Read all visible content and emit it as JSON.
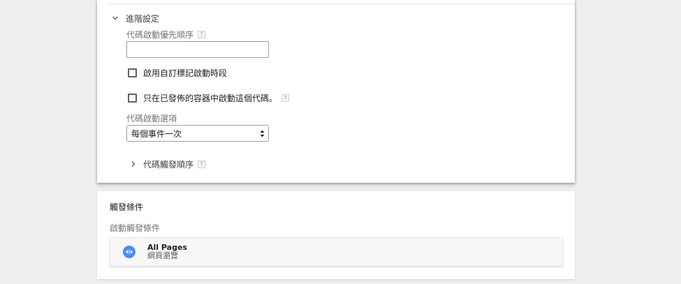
{
  "advanced": {
    "header": "進階設定",
    "priority_label": "代碼啟動優先順序",
    "priority_value": "",
    "custom_schedule_label": "啟用自訂標記啟動時段",
    "custom_schedule_checked": false,
    "published_only_label": "只在已發佈的容器中啟動這個代碼。",
    "published_only_checked": false,
    "firing_options_label": "代碼啟動選項",
    "firing_options_value": "每個事件一次",
    "sequencing_label": "代碼觸發順序",
    "help_glyph": "?"
  },
  "triggering": {
    "title": "觸發條件",
    "subtitle": "啟動觸發條件",
    "trigger": {
      "name": "All Pages",
      "type": "網頁瀏覽",
      "icon": "eye-icon",
      "icon_color": "#4a8ef0"
    }
  }
}
